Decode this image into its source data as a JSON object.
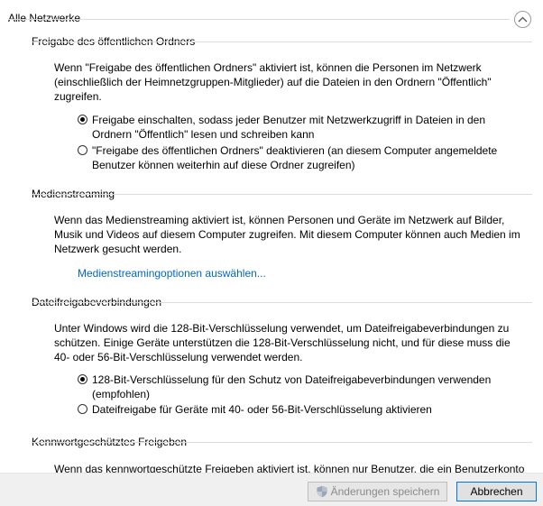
{
  "header": {
    "group_title": "Alle Netzwerke"
  },
  "public_folder": {
    "title": "Freigabe des öffentlichen Ordners",
    "description": "Wenn \"Freigabe des öffentlichen Ordners\" aktiviert ist, können die Personen im Netzwerk (einschließlich der Heimnetzgruppen-Mitglieder) auf die Dateien in den Ordnern \"Öffentlich\" zugreifen.",
    "options": [
      {
        "label": "Freigabe einschalten, sodass jeder Benutzer mit Netzwerkzugriff in Dateien in den Ordnern \"Öffentlich\" lesen und schreiben kann",
        "checked": true
      },
      {
        "label": "\"Freigabe des öffentlichen Ordners\" deaktivieren (an diesem Computer angemeldete Benutzer können weiterhin auf diese Ordner zugreifen)",
        "checked": false
      }
    ]
  },
  "media_streaming": {
    "title": "Medienstreaming",
    "description": "Wenn das Medienstreaming aktiviert ist, können Personen und Geräte im Netzwerk auf Bilder, Musik und Videos auf diesem Computer zugreifen. Mit diesem Computer können auch Medien im Netzwerk gesucht werden.",
    "link": "Medienstreamingoptionen auswählen..."
  },
  "file_sharing": {
    "title": "Dateifreigabeverbindungen",
    "description": "Unter Windows wird die 128-Bit-Verschlüsselung verwendet, um Dateifreigabeverbindungen zu schützen. Einige Geräte unterstützen die 128-Bit-Verschlüsselung nicht, und für diese muss die 40- oder 56-Bit-Verschlüsselung verwendet werden.",
    "options": [
      {
        "label": "128-Bit-Verschlüsselung für den Schutz von Dateifreigabeverbindungen verwenden (empfohlen)",
        "checked": true
      },
      {
        "label": "Dateifreigabe für Geräte mit 40- oder 56-Bit-Verschlüsselung aktivieren",
        "checked": false
      }
    ]
  },
  "password_sharing": {
    "title": "Kennwortgeschütztes Freigeben",
    "description": "Wenn das kennwortgeschützte Freigeben aktiviert ist, können nur Benutzer, die ein Benutzerkonto"
  },
  "footer": {
    "save_label": "Änderungen speichern",
    "cancel_label": "Abbrechen"
  },
  "colors": {
    "link": "#0066cc",
    "footer_bg": "#f0f0f0",
    "primary_border": "#0078d7"
  }
}
